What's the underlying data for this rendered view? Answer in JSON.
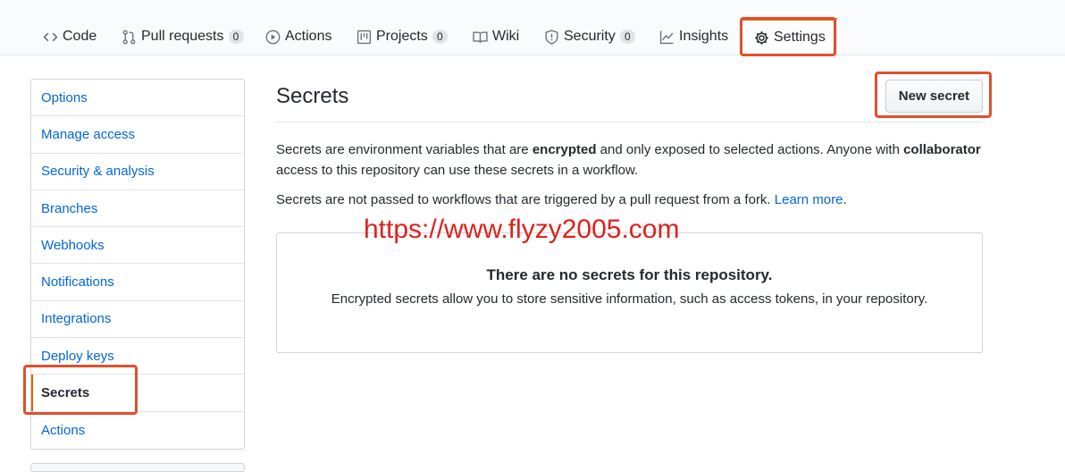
{
  "tabs": {
    "code": {
      "label": "Code",
      "icon": "code-icon"
    },
    "pull_requests": {
      "label": "Pull requests",
      "count": "0",
      "icon": "git-pull-request-icon"
    },
    "actions": {
      "label": "Actions",
      "icon": "play-icon"
    },
    "projects": {
      "label": "Projects",
      "count": "0",
      "icon": "project-icon"
    },
    "wiki": {
      "label": "Wiki",
      "icon": "book-icon"
    },
    "security": {
      "label": "Security",
      "count": "0",
      "icon": "shield-icon"
    },
    "insights": {
      "label": "Insights",
      "icon": "graph-icon"
    },
    "settings": {
      "label": "Settings",
      "icon": "gear-icon",
      "active": true
    }
  },
  "menu": {
    "items": [
      {
        "label": "Options"
      },
      {
        "label": "Manage access"
      },
      {
        "label": "Security & analysis"
      },
      {
        "label": "Branches"
      },
      {
        "label": "Webhooks"
      },
      {
        "label": "Notifications"
      },
      {
        "label": "Integrations"
      },
      {
        "label": "Deploy keys"
      },
      {
        "label": "Secrets",
        "selected": true
      },
      {
        "label": "Actions"
      }
    ]
  },
  "main": {
    "title": "Secrets",
    "new_secret_button": "New secret",
    "intro": {
      "t1": "Secrets are environment variables that are ",
      "b1": "encrypted",
      "t2": " and only exposed to selected actions. Anyone with ",
      "b2": "collaborator",
      "t3": " access to this repository can use these secrets in a workflow."
    },
    "fork_note": {
      "text": "Secrets are not passed to workflows that are triggered by a pull request from a fork. ",
      "link": "Learn more",
      "after": "."
    },
    "empty_state": {
      "title": "There are no secrets for this repository.",
      "description": "Encrypted secrets allow you to store sensitive information, such as access tokens, in your repository."
    }
  },
  "watermark": "https://www.flyzy2005.com",
  "colors": {
    "accent_orange": "#e36209",
    "highlight_box": "#e0502c",
    "link_blue": "#0366d6",
    "watermark_red": "#e0201c"
  }
}
